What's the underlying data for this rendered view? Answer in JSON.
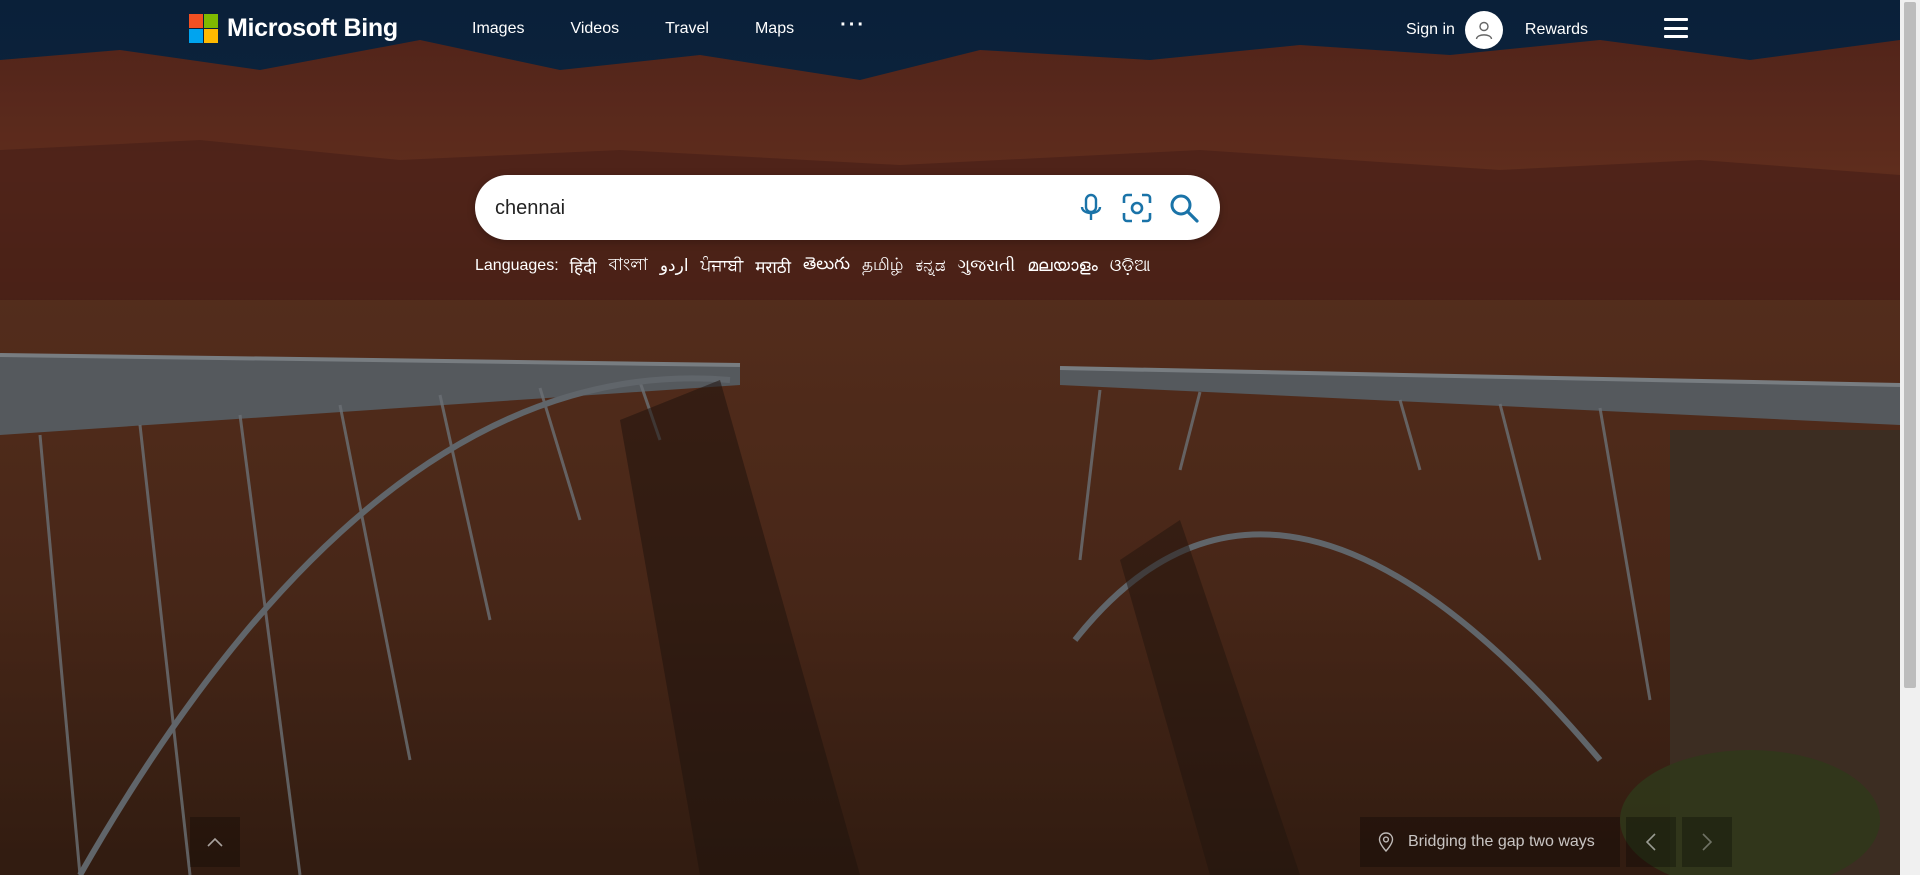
{
  "header": {
    "logo_text": "Microsoft Bing",
    "logo_colors": [
      "#f25022",
      "#7fba00",
      "#00a4ef",
      "#ffb900"
    ],
    "nav": [
      "Images",
      "Videos",
      "Travel",
      "Maps"
    ],
    "more_label": "···",
    "signin_label": "Sign in",
    "rewards_label": "Rewards"
  },
  "search": {
    "value": "chennai",
    "mic_icon": "microphone-icon",
    "visual_icon": "visual-search-icon",
    "search_icon": "search-icon"
  },
  "languages": {
    "label": "Languages:",
    "items": [
      "हिंदी",
      "বাংলা",
      "اردو",
      "ਪੰਜਾਬੀ",
      "मराठी",
      "తెలుగు",
      "தமிழ்",
      "ಕನ್ನಡ",
      "ગુજરાતી",
      "മലയാളം",
      "ଓଡ଼ିଆ"
    ]
  },
  "footer": {
    "caption": "Bridging the gap two ways",
    "caption_icon": "location-pin-icon"
  }
}
